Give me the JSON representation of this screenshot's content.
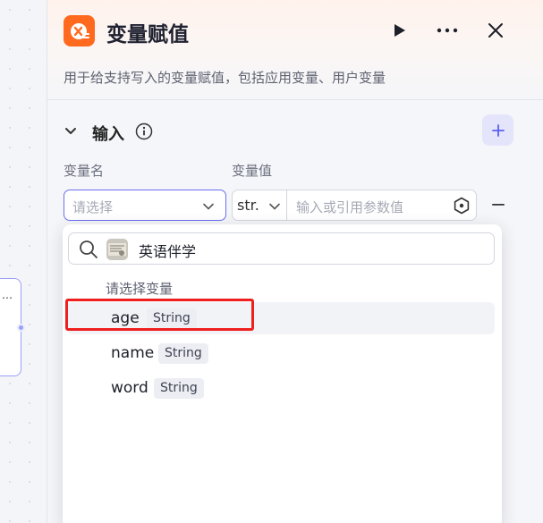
{
  "panel": {
    "title": "变量赋值",
    "description": "用于给支持写入的变量赋值，包括应用变量、用户变量"
  },
  "section": {
    "title": "输入"
  },
  "columns": {
    "name_label": "变量名",
    "value_label": "变量值"
  },
  "row": {
    "variable_placeholder": "请选择",
    "type_value": "str.",
    "value_placeholder": "输入或引用参数值"
  },
  "dropdown": {
    "app_name": "英语伴学",
    "group_label": "请选择变量",
    "options": [
      {
        "name": "age",
        "type": "String"
      },
      {
        "name": "name",
        "type": "String"
      },
      {
        "name": "word",
        "type": "String"
      }
    ]
  },
  "colors": {
    "accent": "#6c6ff0",
    "node_icon": "#ff6a1f",
    "highlight_box": "#ef1f1f"
  }
}
